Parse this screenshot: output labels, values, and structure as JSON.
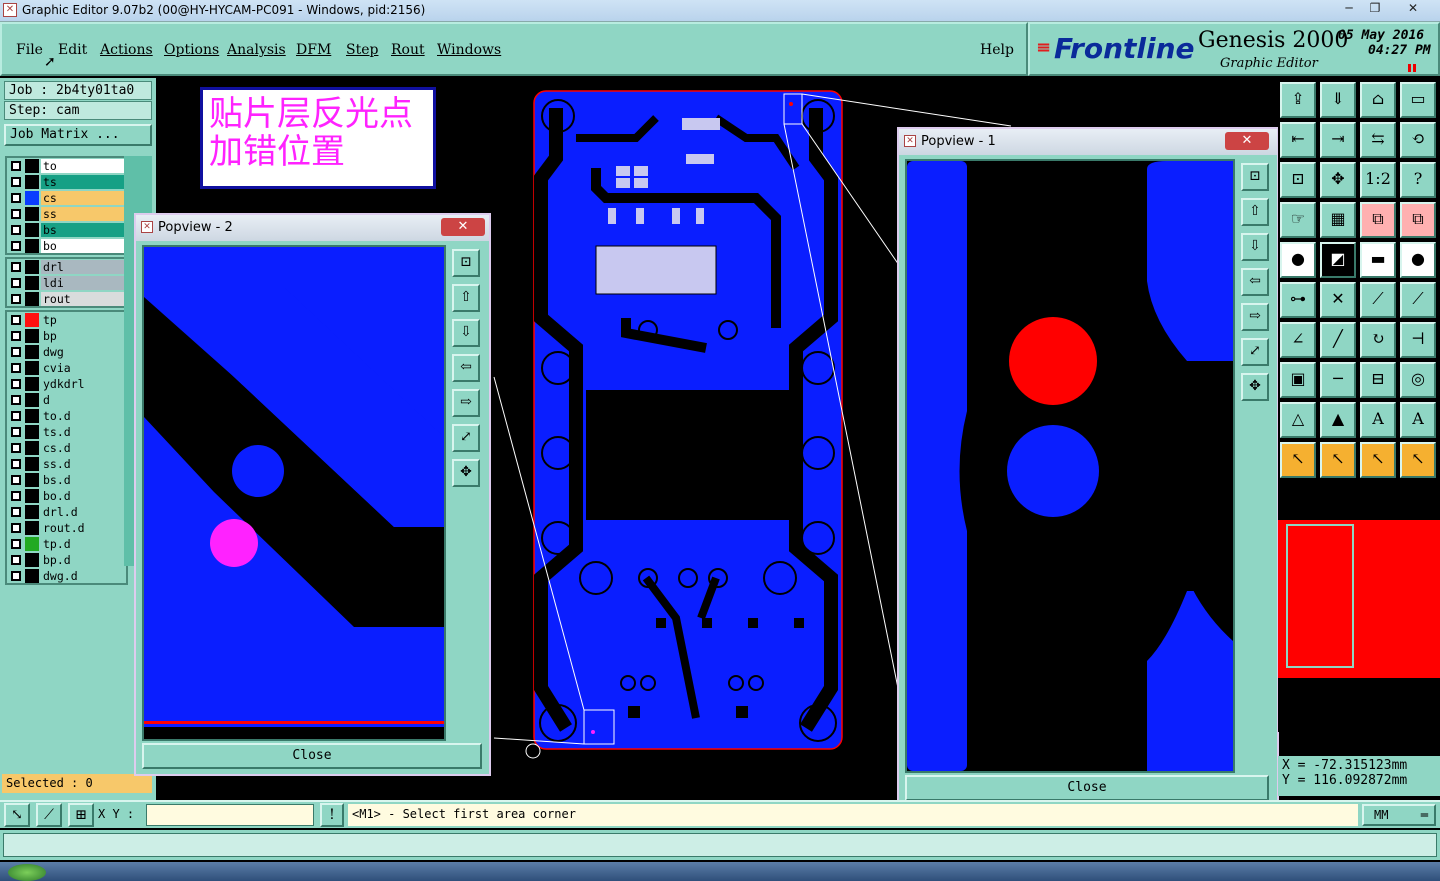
{
  "window": {
    "title": "Graphic Editor 9.07b2 (00@HY-HYCAM-PC091 - Windows, pid:2156)"
  },
  "menu": [
    "File",
    "Edit",
    "Actions",
    "Options",
    "Analysis",
    "DFM",
    "Step",
    "Rout",
    "Windows"
  ],
  "help_label": "Help",
  "brand": {
    "logo": "Frontline",
    "product": "Genesis 2000",
    "subtitle": "Graphic Editor",
    "date": "05 May 2016",
    "time": "04:27 PM"
  },
  "job": {
    "job_label": "Job : 2b4ty01ta0",
    "step_label": "Step: cam",
    "matrix_label": "Job Matrix ..."
  },
  "layers_group1": [
    {
      "name": "to",
      "color": "#000000",
      "bg": "#ffffff"
    },
    {
      "name": "ts",
      "color": "#000000",
      "bg": "#16a085"
    },
    {
      "name": "cs",
      "color": "#0a3cff",
      "bg": "#f7c86a"
    },
    {
      "name": "ss",
      "color": "#000000",
      "bg": "#f7c86a"
    },
    {
      "name": "bs",
      "color": "#000000",
      "bg": "#16a085"
    },
    {
      "name": "bo",
      "color": "#000000",
      "bg": "#ffffff"
    }
  ],
  "layers_group2": [
    {
      "name": "drl",
      "color": "#000000",
      "bg": "#a9b8c0"
    },
    {
      "name": "ldi",
      "color": "#000000",
      "bg": "#a9b8c0"
    },
    {
      "name": "rout",
      "color": "#000000",
      "bg": "#d8dcdc"
    }
  ],
  "layers_group3": [
    {
      "name": "tp",
      "color": "#ff1010",
      "bg": "#8fd6c4"
    },
    {
      "name": "bp",
      "color": "#000000",
      "bg": "#8fd6c4"
    },
    {
      "name": "dwg",
      "color": "#000000",
      "bg": "#8fd6c4"
    },
    {
      "name": "cvia",
      "color": "#000000",
      "bg": "#8fd6c4"
    },
    {
      "name": "ydkdrl",
      "color": "#000000",
      "bg": "#8fd6c4"
    },
    {
      "name": "d",
      "color": "#000000",
      "bg": "#8fd6c4"
    },
    {
      "name": "to.d",
      "color": "#000000",
      "bg": "#8fd6c4"
    },
    {
      "name": "ts.d",
      "color": "#000000",
      "bg": "#8fd6c4"
    },
    {
      "name": "cs.d",
      "color": "#000000",
      "bg": "#8fd6c4"
    },
    {
      "name": "ss.d",
      "color": "#000000",
      "bg": "#8fd6c4"
    },
    {
      "name": "bs.d",
      "color": "#000000",
      "bg": "#8fd6c4"
    },
    {
      "name": "bo.d",
      "color": "#000000",
      "bg": "#8fd6c4"
    },
    {
      "name": "drl.d",
      "color": "#000000",
      "bg": "#8fd6c4"
    },
    {
      "name": "rout.d",
      "color": "#000000",
      "bg": "#8fd6c4"
    },
    {
      "name": "tp.d",
      "color": "#22aa22",
      "bg": "#8fd6c4"
    },
    {
      "name": "bp.d",
      "color": "#000000",
      "bg": "#8fd6c4"
    },
    {
      "name": "dwg.d",
      "color": "#000000",
      "bg": "#8fd6c4"
    }
  ],
  "selected_label": "Selected : 0",
  "note": {
    "line1": "贴片层反光点",
    "line2": "加错位置"
  },
  "popup2": {
    "title": "Popview - 2",
    "close": "Close"
  },
  "popup1": {
    "title": "Popview - 1",
    "close": "Close"
  },
  "coords": {
    "x": "X  =  -72.315123mm",
    "y": "Y  =  116.092872mm"
  },
  "status": {
    "xy_label": "X Y :",
    "xy_value": "",
    "prompt": "<M1> - Select first area corner",
    "units": "MM"
  },
  "colors": {
    "panel": "#8fd6c4",
    "copper": "#0a1eff",
    "red": "#ff0000",
    "magenta": "#ff22ff",
    "pad": "#c8c8f0"
  }
}
